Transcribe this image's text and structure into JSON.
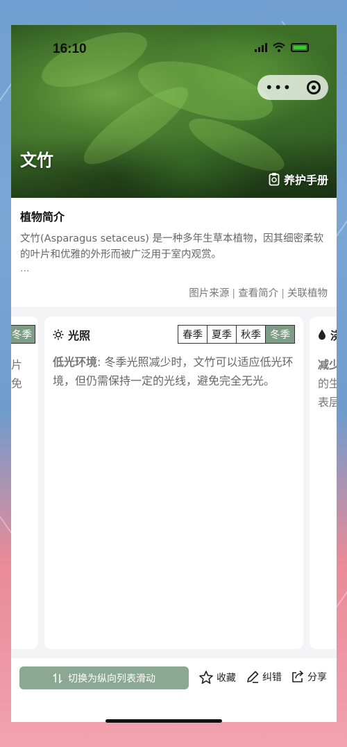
{
  "status": {
    "time": "16:10"
  },
  "hero": {
    "title": "文竹",
    "care_link": "养护手册"
  },
  "intro": {
    "heading": "植物简介",
    "text": "文竹(Asparagus setaceus) 是一种多年生草本植物，因其细密柔软的叶片和优雅的外形而被广泛用于室内观赏。",
    "more": "...",
    "links": [
      "图片来源",
      "查看简介",
      "关联植物"
    ]
  },
  "left_card": {
    "tag": "冬季",
    "lines": [
      "片",
      "免"
    ]
  },
  "main_card": {
    "title": "光照",
    "seasons": [
      "春季",
      "夏季",
      "秋季",
      "冬季"
    ],
    "active_season": "冬季",
    "highlight": "低光环境",
    "text": ": 冬季光照减少时，文竹可以适应低光环境，但仍需保持一定的光线，避免完全无光。"
  },
  "right_card": {
    "title": "浇",
    "lines": [
      "减少",
      "的生",
      "表层"
    ]
  },
  "bottom": {
    "switch_label": "切换为纵向列表滑动",
    "favorite": "收藏",
    "correct": "纠错",
    "share": "分享"
  },
  "colors": {
    "accent": "#7d9e86",
    "button": "#8aa893"
  }
}
